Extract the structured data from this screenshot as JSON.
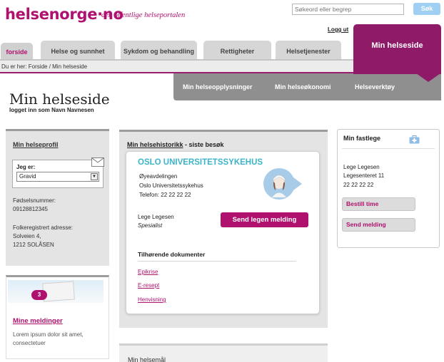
{
  "header": {
    "logo_main": "helsenorge",
    "logo_dot": "·",
    "logo_tld": "no",
    "tagline": "den offentlige helseportalen",
    "search_placeholder": "Søkeord eller begrep",
    "search_button": "Søk",
    "logout": "Logg ut"
  },
  "tabs": [
    {
      "label": "forside"
    },
    {
      "label": "Helse og sunnhet"
    },
    {
      "label": "Sykdom og behandling"
    },
    {
      "label": "Rettigheter"
    },
    {
      "label": "Helsetjenester"
    },
    {
      "label": "Min helseside"
    }
  ],
  "breadcrumb": "Du er her:  Forside / Min helseside",
  "subnav": [
    {
      "label": "Min helseopplysninger"
    },
    {
      "label": "Min helseøkonomi"
    },
    {
      "label": "Helseverktøy"
    }
  ],
  "page": {
    "title": "Min helseside",
    "subtitle": "logget inn som Navn Navnesen"
  },
  "profile": {
    "heading": "Min helseprofil",
    "jeg_er_label": "Jeg er:",
    "jeg_er_value": "Gravid",
    "fnr_label": "Fødselsnummer:",
    "fnr_value": "09128812345",
    "address_label": "Folkeregistrert adresse:",
    "address_line1": "Solveien 4,",
    "address_line2": "1212 SOLÅSEN"
  },
  "messages": {
    "badge": "3",
    "heading": "Mine meldinger",
    "text": "Lorem ipsum dolor sit amet, consectetuer"
  },
  "history": {
    "heading_link": "Min helsehistorikk",
    "heading_rest": " - siste besøk",
    "hospital": "OSLO UNIVERSITETSSYKEHUS",
    "dept": "Øyeavdelingen",
    "hospital_name": "Oslo Universitetssykehus",
    "phone": "Telefon: 22 22 22 22",
    "doctor_name": "Lege Legesen",
    "doctor_role": "Spesialist",
    "send_button": "Send legen melding",
    "docs_heading": "Tilhørende dokumenter",
    "docs": [
      "Epikrise",
      "E-resept",
      "Henvisning"
    ]
  },
  "goals": {
    "heading": "Min helsemål"
  },
  "gp": {
    "heading": "Min fastlege",
    "name": "Lege Legesen",
    "office": "Legesenteret 11",
    "phone": "22 22 22 22",
    "book_button": "Bestill time",
    "message_button": "Send melding"
  },
  "colors": {
    "brand": "#b0116e",
    "brand_dark": "#8f1a68",
    "accent_teal": "#3bb4c8",
    "search_button": "#9fd0f4"
  }
}
